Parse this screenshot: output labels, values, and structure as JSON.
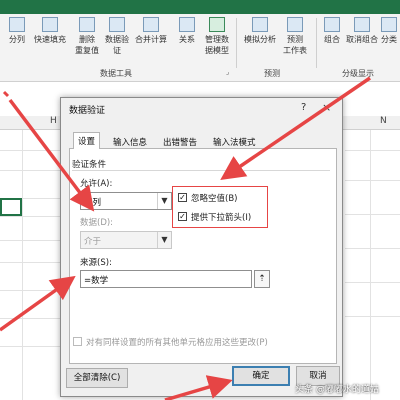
{
  "ribbon": {
    "buttons": [
      {
        "label": "分列",
        "icon": "split-column-icon"
      },
      {
        "label": "快速填充",
        "icon": "flash-fill-icon"
      },
      {
        "label": "删除",
        "label2": "重复值",
        "icon": "remove-duplicates-icon"
      },
      {
        "label": "数据验",
        "label2": "证",
        "icon": "data-validation-icon"
      },
      {
        "label": "合并计算",
        "icon": "consolidate-icon"
      },
      {
        "label": "关系",
        "icon": "relationships-icon"
      },
      {
        "label": "管理数",
        "label2": "据模型",
        "icon": "data-model-icon"
      },
      {
        "label": "模拟分析",
        "icon": "what-if-icon"
      },
      {
        "label": "预测",
        "label2": "工作表",
        "icon": "forecast-sheet-icon"
      },
      {
        "label": "组合",
        "icon": "group-icon"
      },
      {
        "label": "取消组合",
        "icon": "ungroup-icon"
      },
      {
        "label": "分类",
        "icon": "subtotal-icon"
      }
    ],
    "groups": {
      "data_tools": "数据工具",
      "forecast": "预测",
      "outline": "分级显示"
    }
  },
  "sheet": {
    "columns": [
      "H",
      "N"
    ]
  },
  "dialog": {
    "title": "数据验证",
    "help": "?",
    "close": "×",
    "tabs": [
      "设置",
      "输入信息",
      "出错警告",
      "输入法模式"
    ],
    "section_title": "验证条件",
    "allow_label": "允许(A):",
    "allow_value": "序列",
    "data_label": "数据(D):",
    "data_value": "介于",
    "ignore_blank_label": "忽略空值(B)",
    "ignore_blank_checked": true,
    "dropdown_label": "提供下拉箭头(I)",
    "dropdown_checked": true,
    "source_label": "来源(S):",
    "source_value": "=数学",
    "apply_all_label": "对有同样设置的所有其他单元格应用这些更改(P)",
    "apply_all_checked": false,
    "clear_all": "全部清除(C)",
    "ok": "确定",
    "cancel": "取消"
  },
  "watermark": "头条 @嘟嘟水的道姑",
  "colors": {
    "annotation_red": "#e64545",
    "excel_green": "#217346",
    "default_button_border": "#3c7fb1"
  }
}
